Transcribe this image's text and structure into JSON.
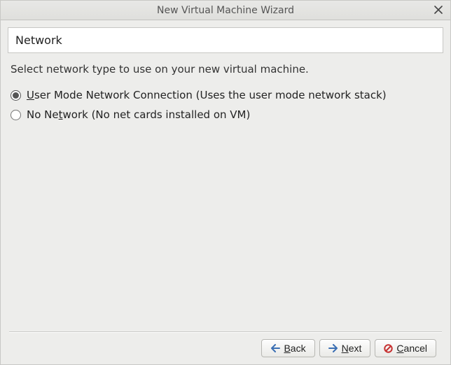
{
  "window": {
    "title": "New Virtual Machine Wizard"
  },
  "page": {
    "header": "Network",
    "description": "Select network type to use on your new virtual machine."
  },
  "options": {
    "user_mode": {
      "pre": "",
      "mn": "U",
      "post": "ser Mode Network Connection (Uses the user mode network stack)",
      "selected": true
    },
    "no_network": {
      "pre": "No Ne",
      "mn": "t",
      "post": "work (No net cards installed on VM)",
      "selected": false
    }
  },
  "buttons": {
    "back": {
      "pre": "",
      "mn": "B",
      "post": "ack"
    },
    "next": {
      "pre": "",
      "mn": "N",
      "post": "ext"
    },
    "cancel": {
      "pre": "",
      "mn": "C",
      "post": "ancel"
    }
  }
}
